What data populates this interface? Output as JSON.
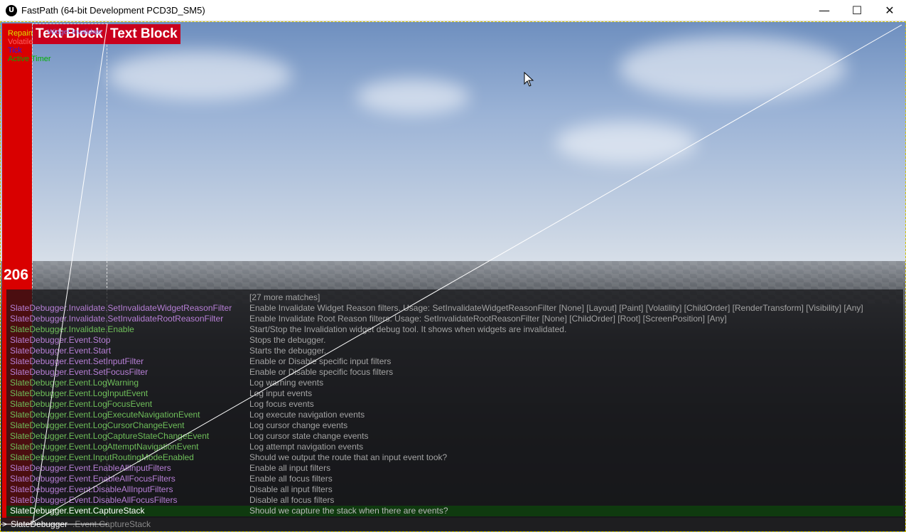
{
  "window": {
    "title": "FastPath (64-bit Development PCD3D_SM5)",
    "app_icon": "U",
    "minimize": "—",
    "maximize": "☐",
    "close": "✕"
  },
  "legend": [
    {
      "label": "Repaint",
      "color": "#e0e000"
    },
    {
      "label": "Volatile Paint",
      "color": "#ffffff"
    },
    {
      "label": "Tick",
      "color": "#1a1aff"
    },
    {
      "label": "Active Timer",
      "color": "#00b000"
    }
  ],
  "overlays": {
    "text_block_1": "Text Block",
    "text_block_2": "Text Block",
    "widget_label": "Widget Invalidate",
    "counter": "206"
  },
  "console": {
    "more_matches": "[27 more matches]",
    "rows": [
      {
        "cmd": "SlateDebugger.Invalidate.SetInvalidateWidgetReasonFilter",
        "desc": "Enable Invalidate Widget Reason filters. Usage: SetInvalidateWidgetReasonFilter [None] [Layout] [Paint] [Volatility] [ChildOrder] [RenderTransform] [Visibility] [Any]",
        "color": "#b77fd6"
      },
      {
        "cmd": "SlateDebugger.Invalidate.SetInvalidateRootReasonFilter",
        "desc": "Enable Invalidate Root Reason filters. Usage: SetInvalidateRootReasonFilter [None] [ChildOrder] [Root] [ScreenPosition] [Any]",
        "color": "#b77fd6"
      },
      {
        "cmd": "SlateDebugger.Invalidate.Enable",
        "desc": "Start/Stop the Invalidation widget debug tool. It shows when widgets are invalidated.",
        "color": "#6fbf5a"
      },
      {
        "cmd": "SlateDebugger.Event.Stop",
        "desc": "Stops the debugger.",
        "color": "#b77fd6"
      },
      {
        "cmd": "SlateDebugger.Event.Start",
        "desc": "Starts the debugger.",
        "color": "#b77fd6"
      },
      {
        "cmd": "SlateDebugger.Event.SetInputFilter",
        "desc": "Enable or Disable specific input filters",
        "color": "#b77fd6"
      },
      {
        "cmd": "SlateDebugger.Event.SetFocusFilter",
        "desc": "Enable or Disable specific focus filters",
        "color": "#b77fd6"
      },
      {
        "cmd": "SlateDebugger.Event.LogWarning",
        "desc": "Log warning events",
        "color": "#6fbf5a"
      },
      {
        "cmd": "SlateDebugger.Event.LogInputEvent",
        "desc": "Log input events",
        "color": "#6fbf5a"
      },
      {
        "cmd": "SlateDebugger.Event.LogFocusEvent",
        "desc": "Log focus events",
        "color": "#6fbf5a"
      },
      {
        "cmd": "SlateDebugger.Event.LogExecuteNavigationEvent",
        "desc": "Log execute navigation events",
        "color": "#6fbf5a"
      },
      {
        "cmd": "SlateDebugger.Event.LogCursorChangeEvent",
        "desc": "Log cursor change events",
        "color": "#6fbf5a"
      },
      {
        "cmd": "SlateDebugger.Event.LogCaptureStateChangeEvent",
        "desc": "Log cursor state change events",
        "color": "#6fbf5a"
      },
      {
        "cmd": "SlateDebugger.Event.LogAttemptNavigationEvent",
        "desc": "Log attempt navigation events",
        "color": "#6fbf5a"
      },
      {
        "cmd": "SlateDebugger.Event.InputRoutingModeEnabled",
        "desc": "Should we output the route that an input event took?",
        "color": "#6fbf5a"
      },
      {
        "cmd": "SlateDebugger.Event.EnableAllInputFilters",
        "desc": "Enable all input filters",
        "color": "#b77fd6"
      },
      {
        "cmd": "SlateDebugger.Event.EnableAllFocusFilters",
        "desc": "Enable all focus filters",
        "color": "#b77fd6"
      },
      {
        "cmd": "SlateDebugger.Event.DisableAllInputFilters",
        "desc": "Disable all input filters",
        "color": "#b77fd6"
      },
      {
        "cmd": "SlateDebugger.Event.DisableAllFocusFilters",
        "desc": "Disable all focus filters",
        "color": "#b77fd6"
      },
      {
        "cmd": "SlateDebugger.Event.CaptureStack",
        "desc": "Should we capture the stack when there are events?",
        "color": "#ffffff",
        "selected": true
      }
    ],
    "input": {
      "prompt": ">",
      "typed": "SlateDebugger",
      "suggestion": ".Event.CaptureStack"
    }
  },
  "colors": {
    "redbar": "#d90000",
    "overlay_red": "#c9001d"
  }
}
